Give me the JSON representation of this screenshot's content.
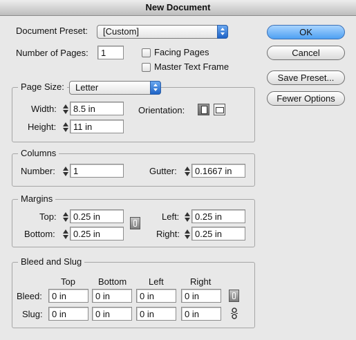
{
  "window": {
    "title": "New Document"
  },
  "preset": {
    "label": "Document Preset:",
    "value": "[Custom]"
  },
  "pages": {
    "label": "Number of Pages:",
    "value": "1"
  },
  "options": {
    "facing_pages": "Facing Pages",
    "master_text_frame": "Master Text Frame"
  },
  "buttons": {
    "ok": "OK",
    "cancel": "Cancel",
    "save_preset": "Save Preset...",
    "fewer_options": "Fewer Options"
  },
  "page_size": {
    "label": "Page Size:",
    "value": "Letter",
    "width_label": "Width:",
    "width": "8.5 in",
    "height_label": "Height:",
    "height": "11 in",
    "orientation_label": "Orientation:"
  },
  "columns": {
    "title": "Columns",
    "number_label": "Number:",
    "number": "1",
    "gutter_label": "Gutter:",
    "gutter": "0.1667 in"
  },
  "margins": {
    "title": "Margins",
    "top_label": "Top:",
    "top": "0.25 in",
    "bottom_label": "Bottom:",
    "bottom": "0.25 in",
    "left_label": "Left:",
    "left": "0.25 in",
    "right_label": "Right:",
    "right": "0.25 in"
  },
  "bleed_slug": {
    "title": "Bleed and Slug",
    "headers": [
      "Top",
      "Bottom",
      "Left",
      "Right"
    ],
    "bleed_label": "Bleed:",
    "bleed": [
      "0 in",
      "0 in",
      "0 in",
      "0 in"
    ],
    "slug_label": "Slug:",
    "slug": [
      "0 in",
      "0 in",
      "0 in",
      "0 in"
    ]
  }
}
